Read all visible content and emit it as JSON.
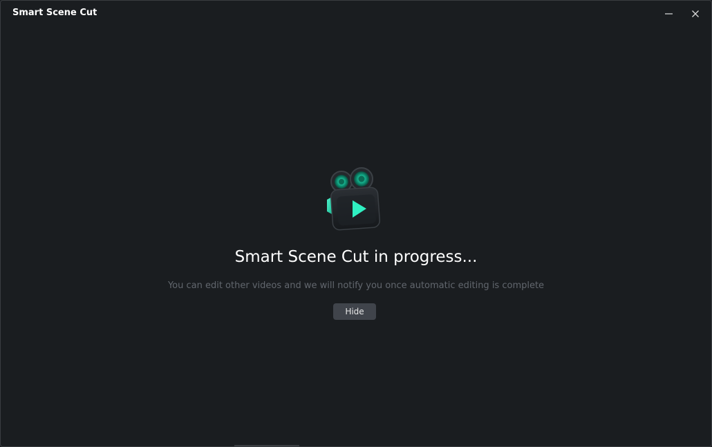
{
  "window": {
    "title": "Smart Scene Cut"
  },
  "controls": {
    "minimize_icon": "minimize-icon",
    "close_icon": "close-icon"
  },
  "main": {
    "icon": "video-camera-icon",
    "heading": "Smart Scene Cut in progress...",
    "subtext": "You can edit other videos and we will notify you once automatic editing is complete",
    "hide_button": "Hide"
  },
  "colors": {
    "background": "#1a1d20",
    "accent": "#1fe0b0",
    "button": "#40444b",
    "subtext": "#62676e"
  }
}
